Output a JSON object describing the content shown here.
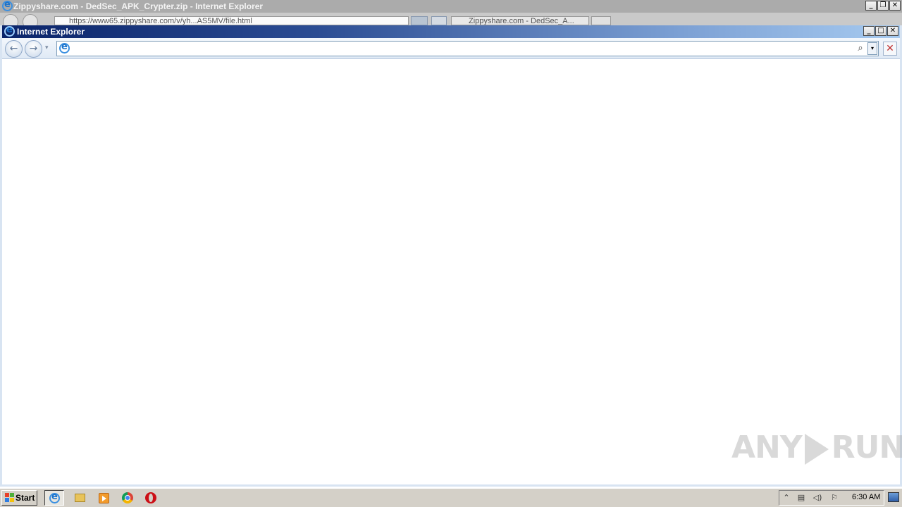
{
  "background_window": {
    "title": "Zippyshare.com - DedSec_APK_Crypter.zip - Internet Explorer",
    "address_text": "https://www65.zippyshare.com/v/yh...AS5MV/file.html",
    "tab_label": "Zippyshare.com - DedSec_A...",
    "caption_buttons": {
      "minimize": "_",
      "restore": "❐",
      "close": "✕"
    }
  },
  "foreground_window": {
    "title": "Internet Explorer",
    "caption_buttons": {
      "minimize": "_",
      "maximize": "□",
      "close": "✕"
    },
    "nav": {
      "back": "←",
      "forward": "→",
      "dropdown": "▾"
    },
    "address": {
      "value": "",
      "search_glyph": "⌕",
      "dropdown_glyph": "▾"
    },
    "stop_glyph": "✕"
  },
  "watermark": {
    "left_text": "ANY",
    "right_text": "RUN"
  },
  "taskbar": {
    "start_label": "Start",
    "apps": [
      {
        "name": "internet-explorer",
        "icon": "ie-icon",
        "active": true
      },
      {
        "name": "windows-explorer",
        "icon": "folder-icon",
        "active": false
      },
      {
        "name": "media-player",
        "icon": "media-player-icon",
        "active": false
      },
      {
        "name": "chrome",
        "icon": "chrome-icon",
        "active": false
      },
      {
        "name": "opera",
        "icon": "opera-icon",
        "active": false
      }
    ],
    "tray": {
      "expand_glyph": "⌃",
      "network_glyph": "▤",
      "volume_glyph": "◁)",
      "flag_glyph": "⚐",
      "clock": "6:30 AM"
    }
  },
  "colors": {
    "active_titlebar_start": "#0a246a",
    "active_titlebar_end": "#a6caf0",
    "inactive_titlebar": "#ababab",
    "taskbar": "#d4d0c8"
  }
}
